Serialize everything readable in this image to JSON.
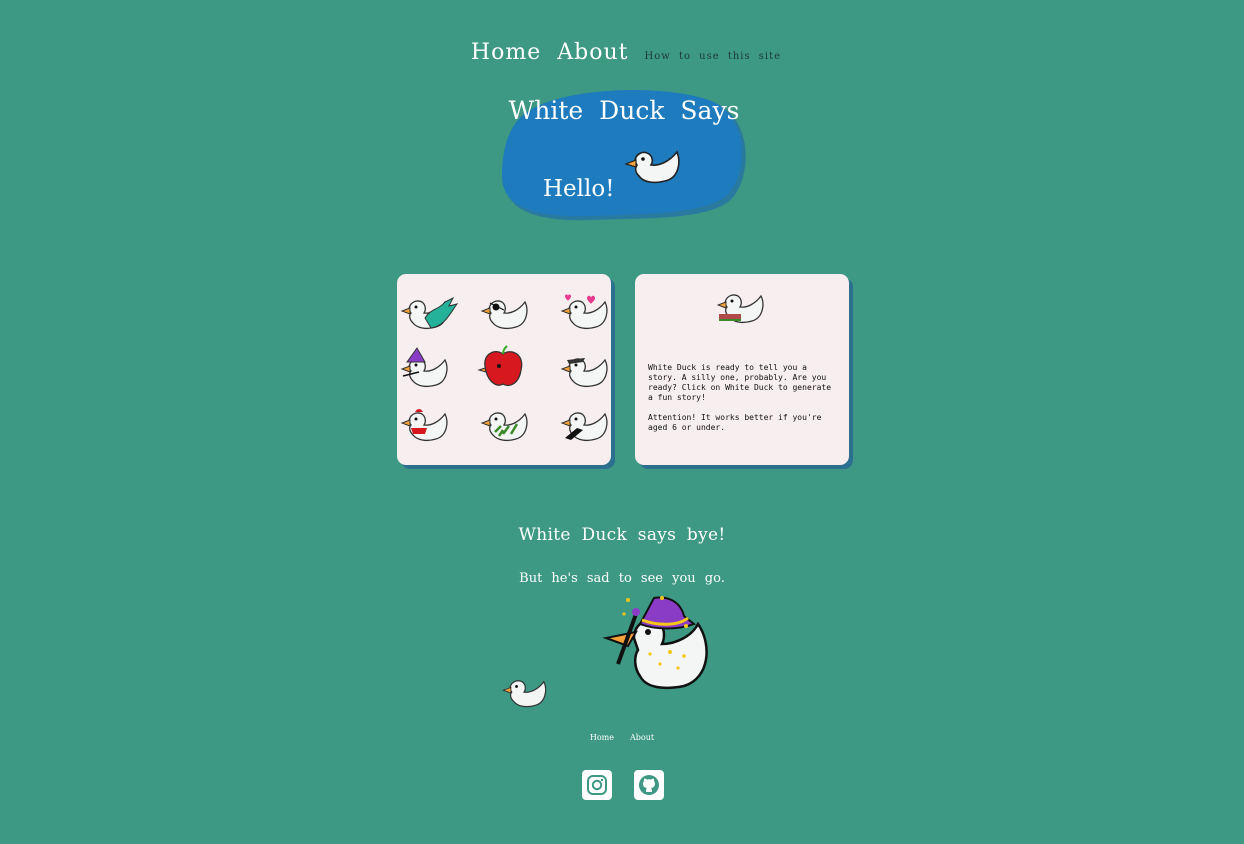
{
  "nav": {
    "home": "Home",
    "about": "About",
    "how_to": "How to use this site"
  },
  "hero": {
    "title": "White Duck Says",
    "greeting": "Hello!"
  },
  "story_card": {
    "paragraph1": "White Duck is ready to tell you a story. A silly one, probably. Are you ready? Click on White Duck to generate a fun story!",
    "paragraph2": "Attention! It works better if you're aged 6 or under."
  },
  "duck_grid": {
    "icons": [
      "mermaid-duck-icon",
      "pirate-duck-icon",
      "love-duck-icon",
      "wizard-duck-icon",
      "apple-duck-icon",
      "hat-duck-icon",
      "scarf-duck-icon",
      "leaf-duck-icon",
      "mustache-duck-icon"
    ]
  },
  "farewell": {
    "title": "White Duck says bye!",
    "subtitle": "But he's sad to see you go."
  },
  "footer": {
    "home": "Home",
    "about": "About",
    "icons": [
      "instagram-icon",
      "github-icon"
    ]
  },
  "colors": {
    "background": "#3d9983",
    "blob": "#1e7bbd",
    "card": "#f7eef0",
    "card_shadow": "#2d6f8e"
  }
}
